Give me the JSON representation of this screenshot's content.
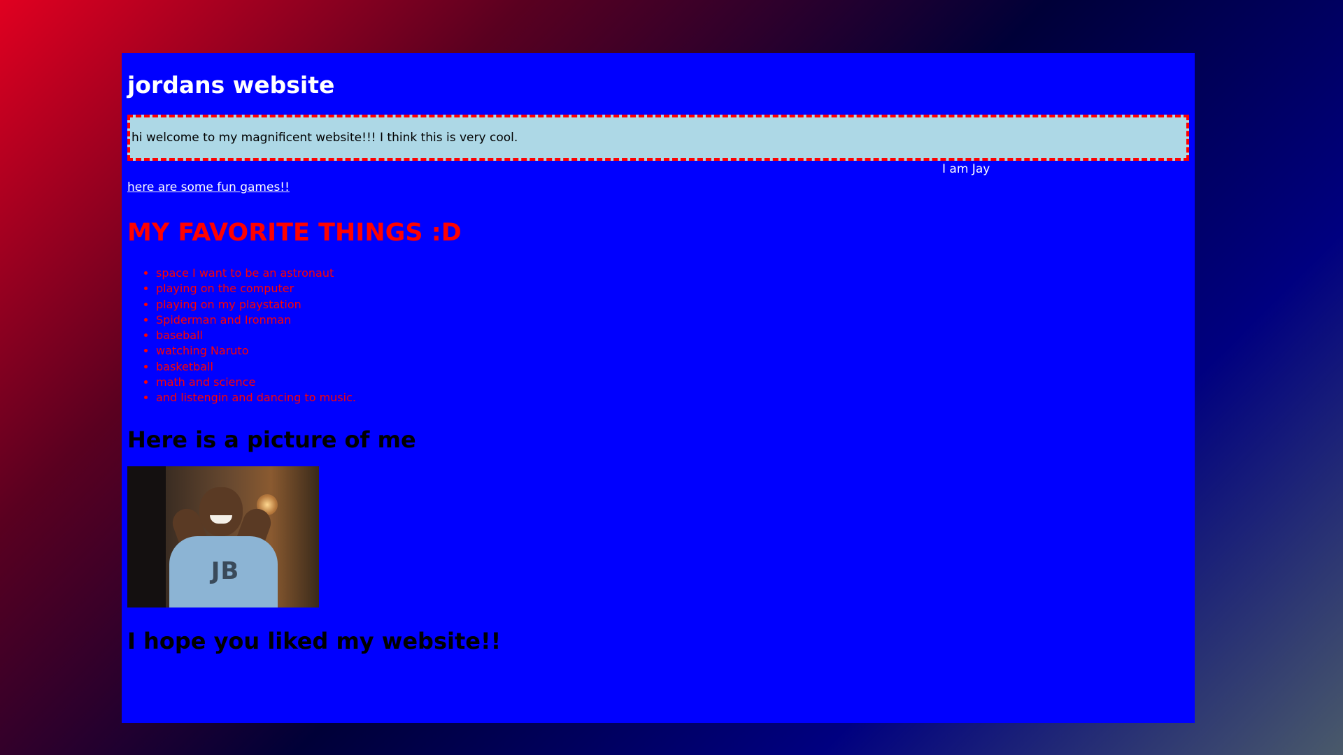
{
  "site": {
    "title": "jordans website",
    "welcome": "hi welcome to my magnificent website!!! I think this is very cool.",
    "caption": "I am Jay",
    "games_link": "here are some fun games!!"
  },
  "favorites": {
    "heading": "MY FAVORITE THINGS :D",
    "items": [
      "space I want to be an astronaut",
      "playing on the computer",
      "playing on my playstation",
      "Spiderman and Ironman",
      "baseball",
      "watching Naruto",
      "basketball",
      "math and science",
      "and listengin and dancing to music."
    ]
  },
  "picture": {
    "heading": "Here is a picture of me",
    "shirt_text": "JB"
  },
  "closing": {
    "text": "I hope you liked my website!!"
  },
  "colors": {
    "page_background": "#0000ff",
    "welcome_box": "#add8e6",
    "welcome_border": "#ff0000",
    "favorites_text": "#ff0000"
  }
}
